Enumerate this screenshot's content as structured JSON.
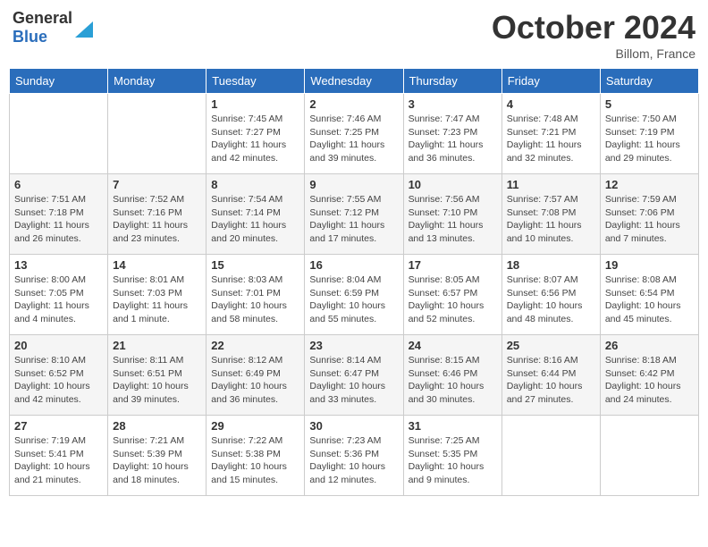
{
  "header": {
    "logo_general": "General",
    "logo_blue": "Blue",
    "month": "October 2024",
    "location": "Billom, France"
  },
  "weekdays": [
    "Sunday",
    "Monday",
    "Tuesday",
    "Wednesday",
    "Thursday",
    "Friday",
    "Saturday"
  ],
  "weeks": [
    [
      null,
      null,
      {
        "day": 1,
        "sunrise": "7:45 AM",
        "sunset": "7:27 PM",
        "daylight": "11 hours and 42 minutes."
      },
      {
        "day": 2,
        "sunrise": "7:46 AM",
        "sunset": "7:25 PM",
        "daylight": "11 hours and 39 minutes."
      },
      {
        "day": 3,
        "sunrise": "7:47 AM",
        "sunset": "7:23 PM",
        "daylight": "11 hours and 36 minutes."
      },
      {
        "day": 4,
        "sunrise": "7:48 AM",
        "sunset": "7:21 PM",
        "daylight": "11 hours and 32 minutes."
      },
      {
        "day": 5,
        "sunrise": "7:50 AM",
        "sunset": "7:19 PM",
        "daylight": "11 hours and 29 minutes."
      }
    ],
    [
      {
        "day": 6,
        "sunrise": "7:51 AM",
        "sunset": "7:18 PM",
        "daylight": "11 hours and 26 minutes."
      },
      {
        "day": 7,
        "sunrise": "7:52 AM",
        "sunset": "7:16 PM",
        "daylight": "11 hours and 23 minutes."
      },
      {
        "day": 8,
        "sunrise": "7:54 AM",
        "sunset": "7:14 PM",
        "daylight": "11 hours and 20 minutes."
      },
      {
        "day": 9,
        "sunrise": "7:55 AM",
        "sunset": "7:12 PM",
        "daylight": "11 hours and 17 minutes."
      },
      {
        "day": 10,
        "sunrise": "7:56 AM",
        "sunset": "7:10 PM",
        "daylight": "11 hours and 13 minutes."
      },
      {
        "day": 11,
        "sunrise": "7:57 AM",
        "sunset": "7:08 PM",
        "daylight": "11 hours and 10 minutes."
      },
      {
        "day": 12,
        "sunrise": "7:59 AM",
        "sunset": "7:06 PM",
        "daylight": "11 hours and 7 minutes."
      }
    ],
    [
      {
        "day": 13,
        "sunrise": "8:00 AM",
        "sunset": "7:05 PM",
        "daylight": "11 hours and 4 minutes."
      },
      {
        "day": 14,
        "sunrise": "8:01 AM",
        "sunset": "7:03 PM",
        "daylight": "11 hours and 1 minute."
      },
      {
        "day": 15,
        "sunrise": "8:03 AM",
        "sunset": "7:01 PM",
        "daylight": "10 hours and 58 minutes."
      },
      {
        "day": 16,
        "sunrise": "8:04 AM",
        "sunset": "6:59 PM",
        "daylight": "10 hours and 55 minutes."
      },
      {
        "day": 17,
        "sunrise": "8:05 AM",
        "sunset": "6:57 PM",
        "daylight": "10 hours and 52 minutes."
      },
      {
        "day": 18,
        "sunrise": "8:07 AM",
        "sunset": "6:56 PM",
        "daylight": "10 hours and 48 minutes."
      },
      {
        "day": 19,
        "sunrise": "8:08 AM",
        "sunset": "6:54 PM",
        "daylight": "10 hours and 45 minutes."
      }
    ],
    [
      {
        "day": 20,
        "sunrise": "8:10 AM",
        "sunset": "6:52 PM",
        "daylight": "10 hours and 42 minutes."
      },
      {
        "day": 21,
        "sunrise": "8:11 AM",
        "sunset": "6:51 PM",
        "daylight": "10 hours and 39 minutes."
      },
      {
        "day": 22,
        "sunrise": "8:12 AM",
        "sunset": "6:49 PM",
        "daylight": "10 hours and 36 minutes."
      },
      {
        "day": 23,
        "sunrise": "8:14 AM",
        "sunset": "6:47 PM",
        "daylight": "10 hours and 33 minutes."
      },
      {
        "day": 24,
        "sunrise": "8:15 AM",
        "sunset": "6:46 PM",
        "daylight": "10 hours and 30 minutes."
      },
      {
        "day": 25,
        "sunrise": "8:16 AM",
        "sunset": "6:44 PM",
        "daylight": "10 hours and 27 minutes."
      },
      {
        "day": 26,
        "sunrise": "8:18 AM",
        "sunset": "6:42 PM",
        "daylight": "10 hours and 24 minutes."
      }
    ],
    [
      {
        "day": 27,
        "sunrise": "7:19 AM",
        "sunset": "5:41 PM",
        "daylight": "10 hours and 21 minutes."
      },
      {
        "day": 28,
        "sunrise": "7:21 AM",
        "sunset": "5:39 PM",
        "daylight": "10 hours and 18 minutes."
      },
      {
        "day": 29,
        "sunrise": "7:22 AM",
        "sunset": "5:38 PM",
        "daylight": "10 hours and 15 minutes."
      },
      {
        "day": 30,
        "sunrise": "7:23 AM",
        "sunset": "5:36 PM",
        "daylight": "10 hours and 12 minutes."
      },
      {
        "day": 31,
        "sunrise": "7:25 AM",
        "sunset": "5:35 PM",
        "daylight": "10 hours and 9 minutes."
      },
      null,
      null
    ]
  ]
}
